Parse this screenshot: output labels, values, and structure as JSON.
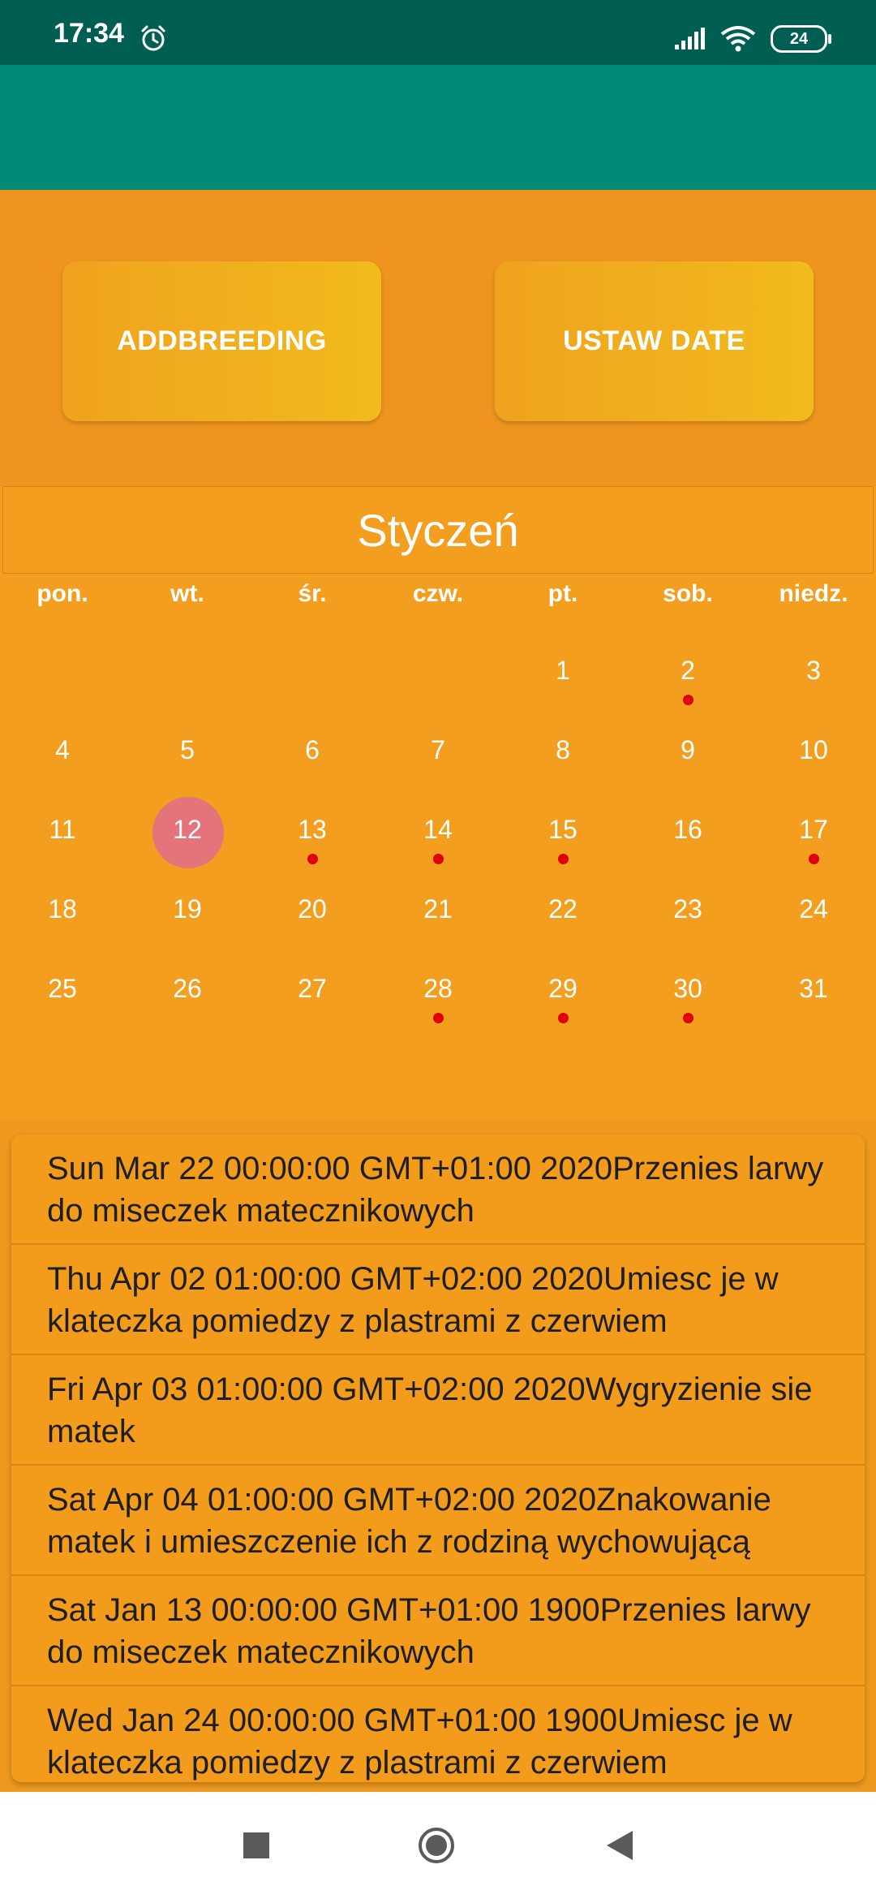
{
  "status_bar": {
    "time": "17:34",
    "battery": "24"
  },
  "buttons": {
    "add_breeding": "ADDBREEDING",
    "set_date": "USTAW DATE"
  },
  "calendar": {
    "month": "Styczeń",
    "weekdays": [
      "pon.",
      "wt.",
      "śr.",
      "czw.",
      "pt.",
      "sob.",
      "niedz."
    ],
    "first_weekday_index": 4,
    "days_in_month": 31,
    "selected_day": 12,
    "marked_days": [
      2,
      13,
      14,
      15,
      17,
      28,
      29,
      30
    ]
  },
  "events": [
    "Sun Mar 22 00:00:00 GMT+01:00 2020Przenies larwy do miseczek matecznikowych",
    "Thu Apr 02 01:00:00 GMT+02:00 2020Umiesc je w klateczka pomiedzy z plastrami z czerwiem",
    "Fri Apr 03 01:00:00 GMT+02:00 2020Wygryzienie sie matek",
    "Sat Apr 04 01:00:00 GMT+02:00 2020Znakowanie matek i umieszczenie ich z rodziną wychowującą",
    "Sat Jan 13 00:00:00 GMT+01:00 1900Przenies larwy do miseczek matecznikowych",
    "Wed Jan 24 00:00:00 GMT+01:00 1900Umiesc je w klateczka pomiedzy z plastrami z czerwiem"
  ],
  "colors": {
    "status_bar": "#015e52",
    "app_bar": "#018b77",
    "background": "#ef951f",
    "button_gradient_start": "#f0a21e",
    "button_gradient_end": "#f1bb1d",
    "event_dot": "#e0000b",
    "selected_day": "#e5737a"
  },
  "nav_icons": [
    "square-icon",
    "circle-home-icon",
    "back-triangle-icon"
  ]
}
